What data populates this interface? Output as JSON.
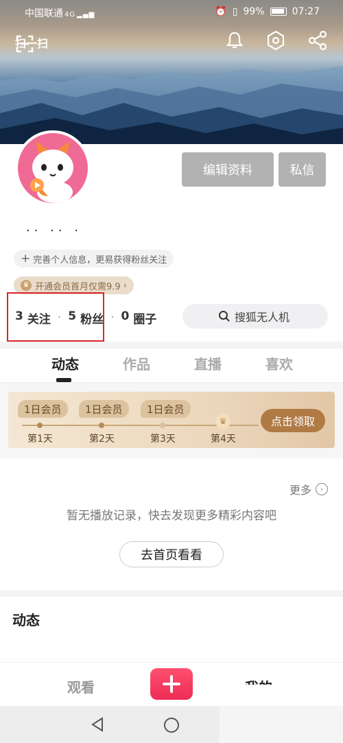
{
  "status_bar": {
    "carrier": "中国联通",
    "network": "4G",
    "battery": "99%",
    "time": "07:27"
  },
  "topbar": {
    "scan_label": "扫一扫"
  },
  "profile": {
    "username": "·· ·· ·",
    "edit_button": "编辑资料",
    "message_button": "私信",
    "complete_info": "完善个人信息，更易获得粉丝关注",
    "vip_promo": "开通会员首月仅需9.9",
    "following_count": "3",
    "following_label": "关注",
    "fans_count": "5",
    "fans_label": "粉丝",
    "circles_count": "0",
    "circles_label": "圈子",
    "search_text": "搜狐无人机"
  },
  "tabs": [
    "动态",
    "作品",
    "直播",
    "喜欢"
  ],
  "reward": {
    "days": [
      {
        "tag": "1日会员",
        "label": "第1天"
      },
      {
        "tag": "1日会员",
        "label": "第2天"
      },
      {
        "tag": "1日会员",
        "label": "第3天"
      },
      {
        "tag": "",
        "label": "第4天"
      }
    ],
    "claim_button": "点击领取"
  },
  "history": {
    "more": "更多",
    "empty_text": "暂无播放记录，快去发现更多精彩内容吧",
    "home_button": "去首页看看"
  },
  "dynamics": {
    "title": "动态"
  },
  "bottom_nav": {
    "watch": "观看",
    "mine": "我的"
  },
  "colors": {
    "accent": "#ee2d55",
    "highlight_box": "#d8262c",
    "reward_button": "#b07a45"
  }
}
